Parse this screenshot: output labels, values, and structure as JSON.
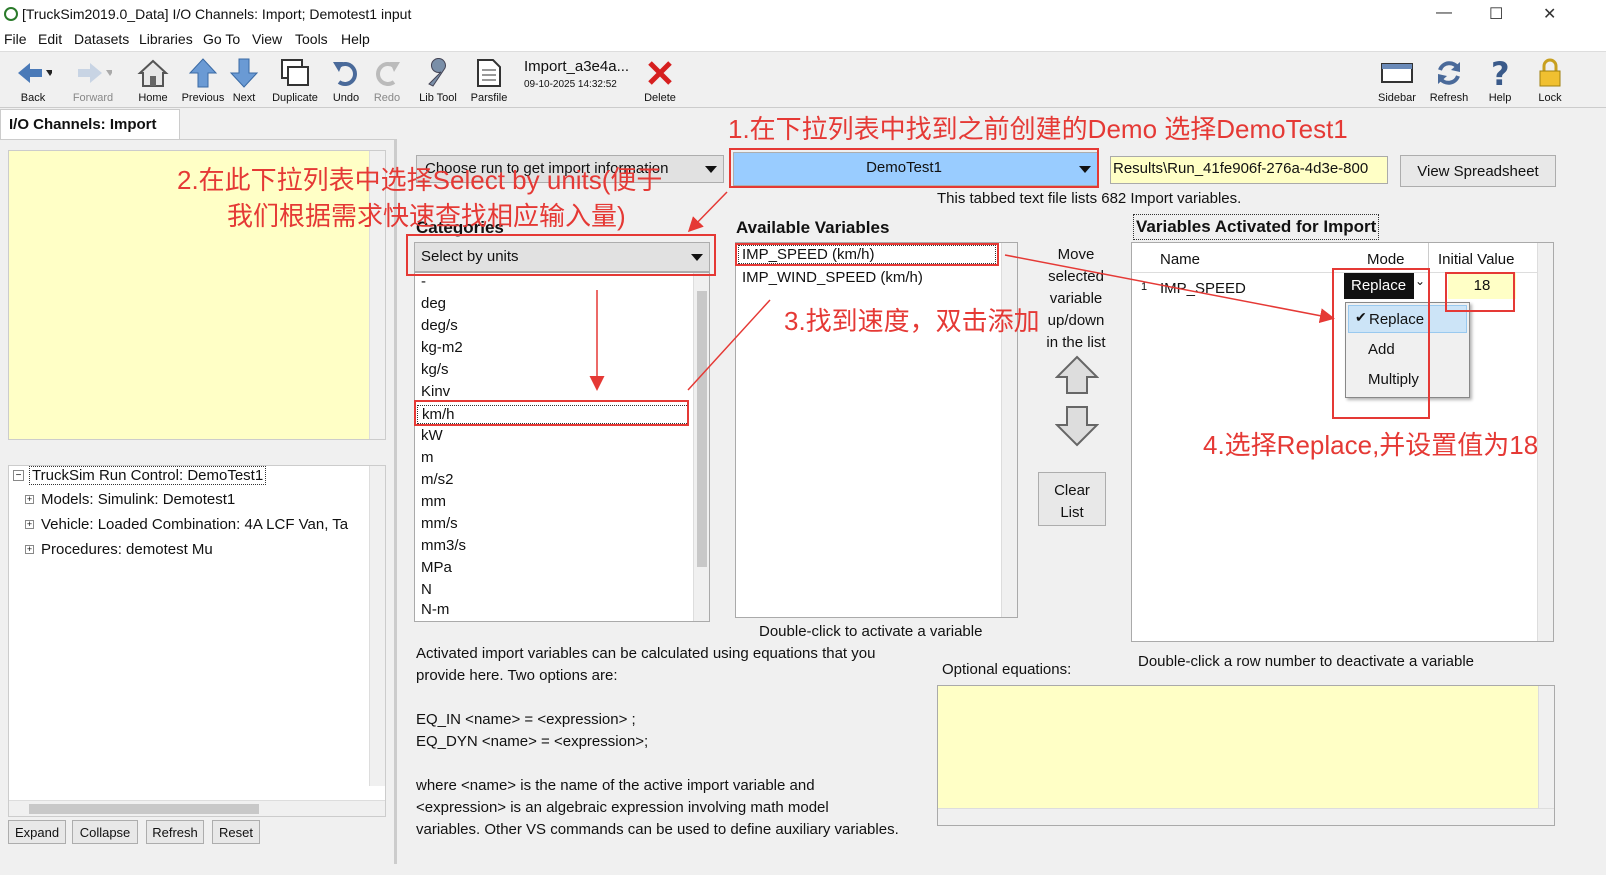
{
  "window": {
    "title": "[TruckSim2019.0_Data] I/O Channels: Import; Demotest1 input",
    "minimize": "—",
    "maximize": "☐",
    "close": "✕"
  },
  "menu": [
    "File",
    "Edit",
    "Datasets",
    "Libraries",
    "Go To",
    "View",
    "Tools",
    "Help"
  ],
  "toolbar": {
    "back": "Back",
    "forward": "Forward",
    "home": "Home",
    "previous": "Previous",
    "next": "Next",
    "duplicate": "Duplicate",
    "undo": "Undo",
    "redo": "Redo",
    "libtool": "Lib Tool",
    "parsfile": "Parsfile",
    "delete": "Delete",
    "sidebar": "Sidebar",
    "refresh": "Refresh",
    "help": "Help",
    "lock": "Lock",
    "parsfile_name": "Import_a3e4a...",
    "parsfile_date": "09-10-2025 14:32:52"
  },
  "tab": {
    "title": "I/O Channels: Import"
  },
  "tree": {
    "root": "TruckSim Run Control: DemoTest1",
    "children": [
      "Models: Simulink: Demotest1",
      "Vehicle: Loaded Combination: 4A LCF Van, Ta",
      "Procedures: demotest Mu"
    ]
  },
  "bottom_buttons": {
    "expand": "Expand",
    "collapse": "Collapse",
    "refresh": "Refresh",
    "reset": "Reset"
  },
  "run_combo": {
    "value": "Choose run to get import information"
  },
  "demo_combo": {
    "value": "DemoTest1"
  },
  "results_path": "Results\\Run_41fe906f-276a-4d3e-800",
  "view_spreadsheet": "View Spreadsheet",
  "file_info": "This tabbed text file lists 682 Import variables.",
  "categories": {
    "header": "Categories",
    "combo_value": "Select by units",
    "items": [
      "-",
      "deg",
      "deg/s",
      "kg-m2",
      "kg/s",
      "Kinv",
      "km/h",
      "kW",
      "m",
      "m/s2",
      "mm",
      "mm/s",
      "mm3/s",
      "MPa",
      "N",
      "N-m"
    ],
    "selected": "km/h"
  },
  "available": {
    "header": "Available Variables",
    "items": [
      "IMP_SPEED (km/h)",
      "IMP_WIND_SPEED (km/h)"
    ],
    "hint": "Double-click to activate a variable"
  },
  "move": {
    "label_lines": [
      "Move",
      "selected",
      "variable",
      "up/down",
      "in the list"
    ],
    "clear_lines": [
      "Clear",
      "List"
    ]
  },
  "activated": {
    "header": "Variables Activated for Import",
    "col_name": "Name",
    "col_mode": "Mode",
    "col_initial": "Initial Value",
    "row_num": "1",
    "row_name": "IMP_SPEED",
    "row_mode": "Replace",
    "row_initial": "18",
    "mode_options": [
      "Replace",
      "Add",
      "Multiply"
    ],
    "hint": "Double-click a row number to deactivate a variable"
  },
  "equations": {
    "intro": [
      "Activated import variables can be calculated using equations that you",
      "provide here. Two options are:"
    ],
    "eq1": "EQ_IN <name> = <expression> ;",
    "eq2": "EQ_DYN <name> = <expression>;",
    "where": [
      "where <name> is the name of the active import variable and",
      "<expression> is an algebraic expression involving math model",
      "variables. Other VS commands can be used to define auxiliary variables."
    ],
    "optional_label": "Optional equations:"
  },
  "annotations": {
    "a1": "1.在下拉列表中找到之前创建的Demo 选择DemoTest1",
    "a2_line1": "2.在此下拉列表中选择Select by units(便于",
    "a2_line2": "我们根据需求快速查找相应输入量)",
    "a3": "3.找到速度，双击添加",
    "a4": "4.选择Replace,并设置值为18"
  },
  "colors": {
    "annotation": "#e53935",
    "yellow_panel": "#ffffc6",
    "selected_blue": "#99ccff"
  }
}
